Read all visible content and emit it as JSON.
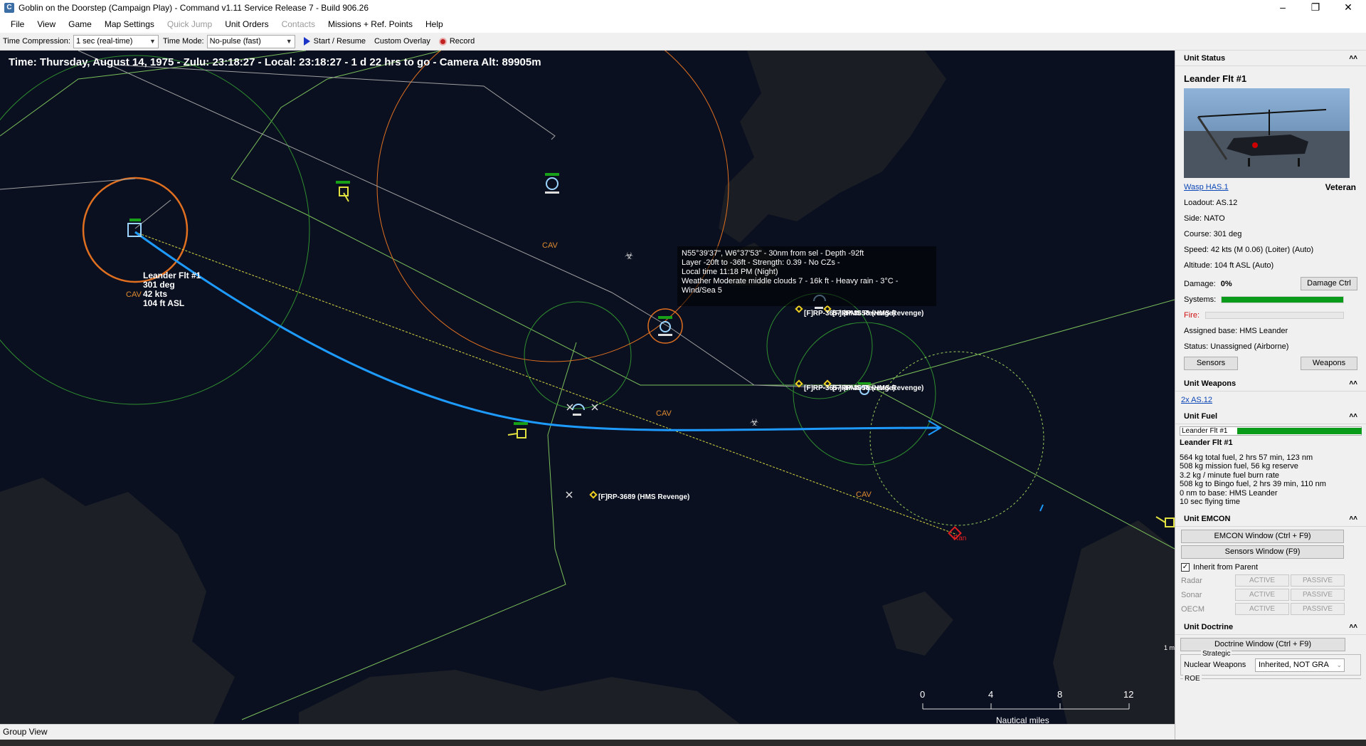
{
  "window": {
    "title": "Goblin on the Doorstep (Campaign Play) - Command v1.11 Service Release 7 - Build 906.26",
    "icon": "app-icon"
  },
  "menu": [
    "File",
    "View",
    "Game",
    "Map Settings",
    "Quick Jump",
    "Unit Orders",
    "Contacts",
    "Missions + Ref. Points",
    "Help"
  ],
  "toolbar": {
    "time_compression_label": "Time Compression:",
    "time_compression_value": "1 sec (real-time)",
    "time_mode_label": "Time Mode:",
    "time_mode_value": "No-pulse (fast)",
    "start_resume": "Start / Resume",
    "custom_overlay": "Custom Overlay",
    "record": "Record"
  },
  "map": {
    "time_line": "Time: Thursday, August 14, 1975 - Zulu: 23:18:27 - Local: 23:18:27 - 1 d 22 hrs to go -  Camera Alt: 89905m",
    "hover": [
      "N55°39'37\", W6°37'53\" - 30nm from sel - Depth -92ft",
      "Layer -20ft to -36ft - Strength: 0.39 - No CZs -",
      "Local time 11:18 PM (Night)",
      "Weather Moderate middle clouds 7 - 16k ft - Heavy rain - 3°C - Wind/Sea 5"
    ],
    "selected_unit": {
      "name": "Leander Flt #1",
      "course": "301 deg",
      "speed": "42 kts",
      "alt": "104 ft ASL",
      "tag": "CAV"
    },
    "cav_label": "CAV",
    "rp_labels": [
      "[F]RP-3657 (HMS Revenge)",
      "[F]RP-3658 (HMS Revenge)",
      "[F]RP-3689 (HMS Revenge)"
    ],
    "target_label": "Ran",
    "edge_label": "1 m",
    "scale": {
      "ticks": [
        "0",
        "4",
        "8",
        "12"
      ],
      "unit": "Nautical miles"
    },
    "colors": {
      "route": "#1e9bff",
      "range_ring": "#e07020",
      "zone": "#7bbf5a"
    }
  },
  "statusbar": {
    "text": "Group View"
  },
  "panel": {
    "unit_status": {
      "header": "Unit Status",
      "unit_name": "Leander Flt #1",
      "aircraft_link": "Wasp HAS.1",
      "proficiency": "Veteran",
      "loadout": "Loadout: AS.12",
      "side": "Side: NATO",
      "course": "Course: 301 deg",
      "speed": "Speed: 42 kts (M 0.06) (Loiter)   (Auto)",
      "altitude": "Altitude: 104 ft ASL    (Auto)",
      "damage_label": "Damage:",
      "damage_value": "0%",
      "damage_ctrl": "Damage Ctrl",
      "systems_label": "Systems:",
      "systems_level": 1.0,
      "fire_label": "Fire:",
      "fire_level": 0.0,
      "assigned_base": "Assigned base: HMS Leander",
      "status": "Status: Unassigned (Airborne)",
      "sensors_btn": "Sensors",
      "weapons_btn": "Weapons"
    },
    "unit_weapons": {
      "header": "Unit Weapons",
      "item": "2x AS.12"
    },
    "unit_fuel": {
      "header": "Unit Fuel",
      "bar_label": "Leander Flt #1",
      "bar_level": 1.0,
      "title": "Leander Flt #1",
      "lines": [
        "564 kg total fuel, 2 hrs 57 min, 123 nm",
        "508 kg mission fuel, 56 kg reserve",
        "3.2 kg / minute fuel burn rate",
        "508 kg to Bingo fuel, 2 hrs 39 min, 110 nm",
        "0 nm to base: HMS Leander",
        "10 sec flying time"
      ]
    },
    "unit_emcon": {
      "header": "Unit EMCON",
      "emcon_btn": "EMCON Window (Ctrl + F9)",
      "sensors_btn": "Sensors Window (F9)",
      "inherit": "Inherit from Parent",
      "rows": [
        {
          "name": "Radar",
          "a": "ACTIVE",
          "p": "PASSIVE"
        },
        {
          "name": "Sonar",
          "a": "ACTIVE",
          "p": "PASSIVE"
        },
        {
          "name": "OECM",
          "a": "ACTIVE",
          "p": "PASSIVE"
        }
      ]
    },
    "unit_doctrine": {
      "header": "Unit Doctrine",
      "doctrine_btn": "Doctrine Window (Ctrl + F9)",
      "group_label": "Strategic",
      "nuclear_label": "Nuclear Weapons",
      "nuclear_value": "Inherited, NOT GRA",
      "roe_label": "ROE"
    }
  }
}
